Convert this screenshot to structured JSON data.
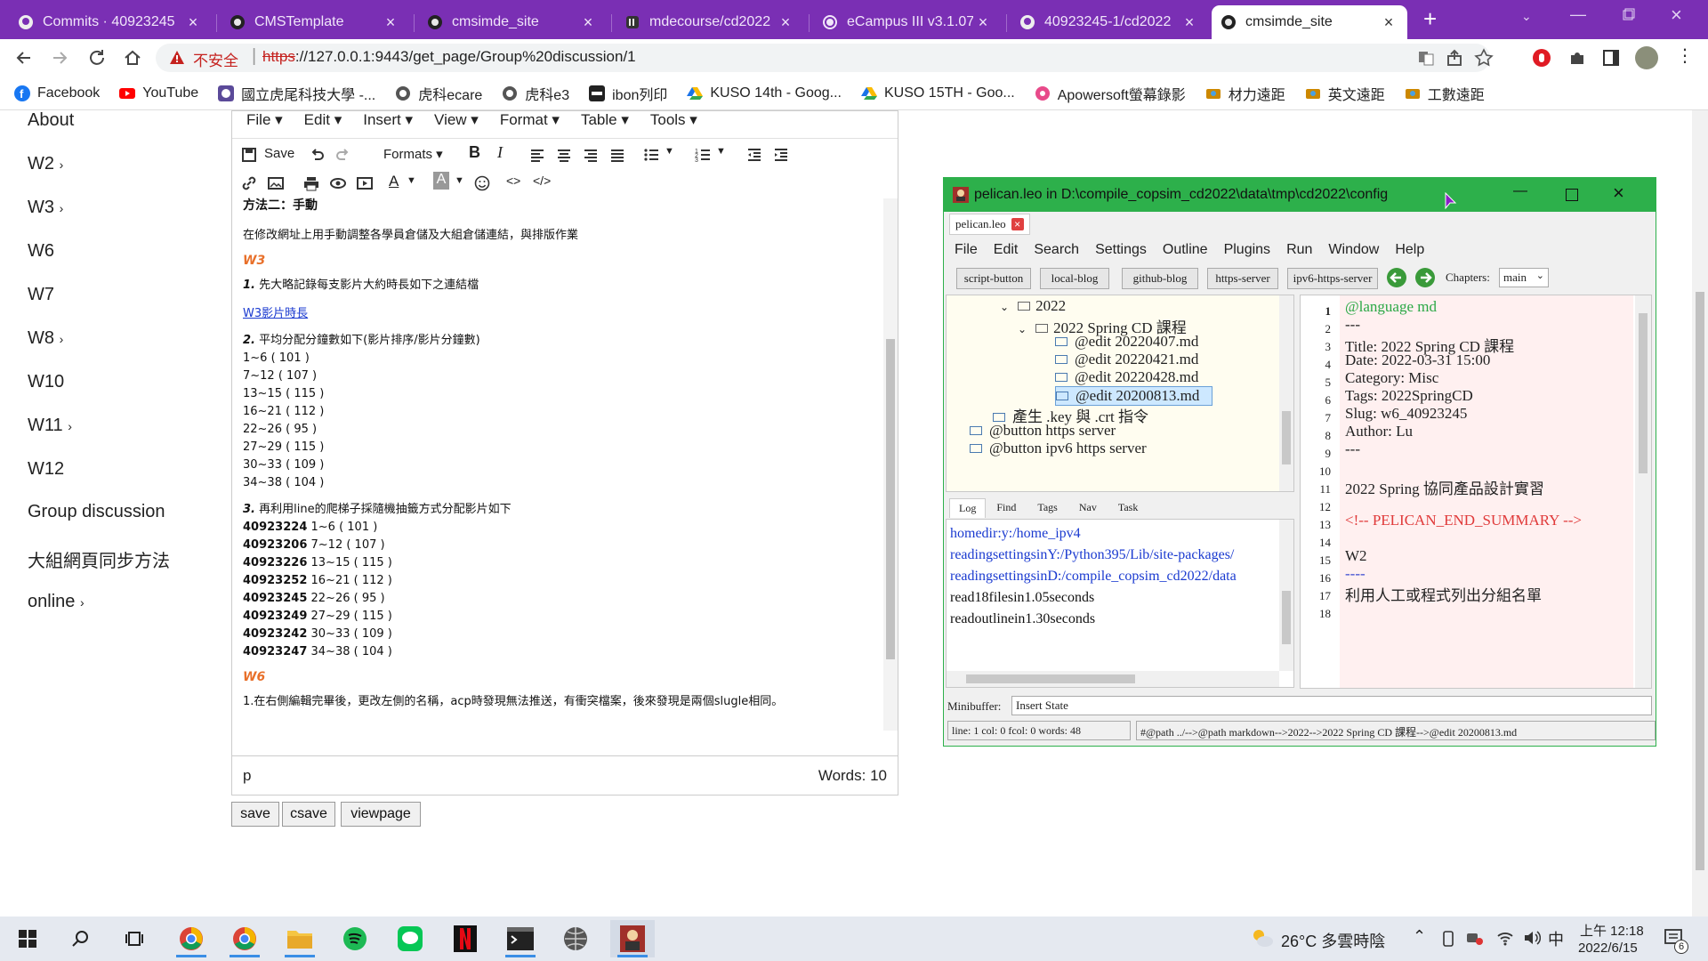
{
  "browser": {
    "tabs": [
      {
        "title": "Commits · 40923245",
        "icon": "github-icon"
      },
      {
        "title": "CMSTemplate",
        "icon": "leo-icon"
      },
      {
        "title": "cmsimde_site",
        "icon": "leo-icon"
      },
      {
        "title": "mdecourse/cd2022",
        "icon": "github-icon"
      },
      {
        "title": "eCampus III v3.1.079",
        "icon": "globe-icon"
      },
      {
        "title": "40923245-1/cd2022",
        "icon": "github-icon"
      },
      {
        "title": "cmsimde_site",
        "icon": "leo-icon",
        "active": true
      }
    ],
    "address": {
      "security": "不安全",
      "url_scheme": "https",
      "url_rest": "://127.0.0.1:9443/get_page/Group%20discussion/1"
    },
    "bookmarks": [
      {
        "label": "Facebook",
        "color": "#1877f2"
      },
      {
        "label": "YouTube",
        "color": "#ff0000"
      },
      {
        "label": "國立虎尾科技大學 -...",
        "color": "#5b4a99"
      },
      {
        "label": "虎科ecare",
        "color": "#555555"
      },
      {
        "label": "虎科e3",
        "color": "#555555"
      },
      {
        "label": "ibon列印",
        "color": "#222222"
      },
      {
        "label": "KUSO 14th - Goog...",
        "color": "#1a73e8"
      },
      {
        "label": "KUSO 15TH - Goo...",
        "color": "#1a73e8"
      },
      {
        "label": "Apowersoft螢幕錄影",
        "color": "#e84a8a"
      },
      {
        "label": "材力遠距",
        "color": "#cc8800"
      },
      {
        "label": "英文遠距",
        "color": "#cc8800"
      },
      {
        "label": "工數遠距",
        "color": "#cc8800"
      }
    ]
  },
  "sidenav": {
    "items": [
      {
        "label": "About",
        "has_arrow": false
      },
      {
        "label": "W2",
        "has_arrow": true
      },
      {
        "label": "W3",
        "has_arrow": true
      },
      {
        "label": "W6",
        "has_arrow": false
      },
      {
        "label": "W7",
        "has_arrow": false
      },
      {
        "label": "W8",
        "has_arrow": true
      },
      {
        "label": "W10",
        "has_arrow": false
      },
      {
        "label": "W11",
        "has_arrow": true
      },
      {
        "label": "W12",
        "has_arrow": false
      },
      {
        "label": "Group discussion",
        "has_arrow": false
      },
      {
        "label": "大組網頁同步方法",
        "has_arrow": false
      },
      {
        "label": "online",
        "has_arrow": true
      }
    ],
    "arrow": "›"
  },
  "editor": {
    "menus": [
      "File",
      "Edit",
      "Insert",
      "View",
      "Format",
      "Table",
      "Tools"
    ],
    "toolbar": {
      "save": "Save",
      "formats": "Formats"
    },
    "content": {
      "h_method2": "方法二：手動",
      "p_intro": "在修改網址上用手動調整各學員倉儲及大組倉儲連結，與排版作業",
      "w3": "W3",
      "s1_num": "1.",
      "s1_text": " 先大略記錄每支影片大約時長如下之連結檔",
      "link": "W3影片時長",
      "s2_num": "2.",
      "s2_text": " 平均分配分鐘數如下(影片排序/影片分鐘數)",
      "ranges": [
        "1~6 ( 101 )",
        "7~12 ( 107 )",
        "13~15 ( 115 )",
        "16~21 ( 112 )",
        "22~26 ( 95 )",
        "27~29 ( 115 )",
        "30~33 ( 109 )",
        "34~38 ( 104 )"
      ],
      "s3_num": "3.",
      "s3_text": " 再利用line的爬梯子採隨機抽籤方式分配影片如下",
      "assignments": [
        {
          "id": "40923224",
          "range": " 1~6 ( 101 )"
        },
        {
          "id": "40923206",
          "range": " 7~12 ( 107 )"
        },
        {
          "id": "40923226",
          "range": " 13~15 ( 115 )"
        },
        {
          "id": "40923252",
          "range": " 16~21 ( 112 )"
        },
        {
          "id": "40923245",
          "range": " 22~26 ( 95 )"
        },
        {
          "id": "40923249",
          "range": " 27~29 ( 115 )"
        },
        {
          "id": "40923242",
          "range": " 30~33 ( 109 )"
        },
        {
          "id": "40923247",
          "range": " 34~38 ( 104 )"
        }
      ],
      "w6": "W6",
      "w6_text": "1.在右側編輯完畢後，更改左側的名稱，acp時發現無法推送，有衝突檔案，後來發現是兩個slugle相同。"
    },
    "status_path": "p",
    "word_count": "Words: 10"
  },
  "buttons": {
    "save": "save",
    "csave": "csave",
    "viewpage": "viewpage"
  },
  "leo": {
    "title": "pelican.leo in D:\\compile_copsim_cd2022\\data\\tmp\\cd2022\\config",
    "file_tab": "pelican.leo",
    "menus": [
      "File",
      "Edit",
      "Search",
      "Settings",
      "Outline",
      "Plugins",
      "Run",
      "Window",
      "Help"
    ],
    "buttons": [
      "script-button",
      "local-blog",
      "github-blog",
      "https-server",
      "ipv6-https-server"
    ],
    "chapters_label": "Chapters:",
    "chapters_value": "main",
    "tree": [
      {
        "label": "2022",
        "indent": 3,
        "arrow": "v"
      },
      {
        "label": "2022 Spring CD 課程",
        "indent": 4,
        "arrow": "v"
      },
      {
        "label": "@edit 20220407.md",
        "indent": 5
      },
      {
        "label": "@edit 20220421.md",
        "indent": 5
      },
      {
        "label": "@edit 20220428.md",
        "indent": 5
      },
      {
        "label": "@edit 20200813.md",
        "indent": 5,
        "selected": true
      },
      {
        "label": "產生 .key 與 .crt 指令",
        "indent": 3
      },
      {
        "label": "@button https server",
        "indent": 2
      },
      {
        "label": "@button ipv6 https server",
        "indent": 2
      }
    ],
    "log_tabs": [
      "Log",
      "Find",
      "Tags",
      "Nav",
      "Task"
    ],
    "log_lines": [
      {
        "text": "homedir:y:/home_ipv4",
        "color": "#1a3ad0"
      },
      {
        "text": "readingsettingsinY:/Python395/Lib/site-packages/",
        "color": "#1a3ad0"
      },
      {
        "text": "readingsettingsinD:/compile_copsim_cd2022/data",
        "color": "#1a3ad0"
      },
      {
        "text": "read18filesin1.05seconds",
        "color": "#111111"
      },
      {
        "text": "readoutlinein1.30seconds",
        "color": "#111111"
      }
    ],
    "body_lines": [
      {
        "n": "1",
        "text": "@language md",
        "color": "#2aa845"
      },
      {
        "n": "2",
        "text": "---",
        "color": "#222222"
      },
      {
        "n": "3",
        "text": "Title: 2022 Spring CD 課程",
        "color": "#111111"
      },
      {
        "n": "4",
        "text": "Date: 2022-03-31 15:00",
        "color": "#111111"
      },
      {
        "n": "5",
        "text": "Category: Misc",
        "color": "#111111"
      },
      {
        "n": "6",
        "text": "Tags: 2022SpringCD",
        "color": "#111111"
      },
      {
        "n": "7",
        "text": "Slug: w6_40923245",
        "color": "#111111"
      },
      {
        "n": "8",
        "text": "Author: Lu",
        "color": "#111111"
      },
      {
        "n": "9",
        "text": "---",
        "color": "#222222"
      },
      {
        "n": "10",
        "text": "",
        "color": "#111111"
      },
      {
        "n": "11",
        "text": "2022 Spring 協同產品設計實習",
        "color": "#111111"
      },
      {
        "n": "12",
        "text": "",
        "color": "#111111"
      },
      {
        "n": "13",
        "text": "<!-- PELICAN_END_SUMMARY -->",
        "color": "#e03a3a"
      },
      {
        "n": "14",
        "text": "",
        "color": "#111111"
      },
      {
        "n": "15",
        "text": "W2",
        "color": "#111111"
      },
      {
        "n": "16",
        "text": "----",
        "color": "#3a4ad0"
      },
      {
        "n": "17",
        "text": "利用人工或程式列出分組名單",
        "color": "#111111"
      },
      {
        "n": "18",
        "text": "",
        "color": "#111111"
      }
    ],
    "minibuffer_label": "Minibuffer:",
    "minibuffer_value": "Insert State",
    "status_left": "line: 1 col: 0  fcol: 0 words: 48",
    "status_right": "#@path ../-->@path markdown-->2022-->2022 Spring CD 課程-->@edit 20200813.md"
  },
  "taskbar": {
    "weather": "26°C  多雲時陰",
    "ime": "中",
    "time": "上午 12:18",
    "date": "2022/6/15",
    "notifications": "6"
  },
  "colors": {
    "accent": "#7a2fb4",
    "leo_title": "#2db04b",
    "tab_w_orange": "#e8702a"
  }
}
